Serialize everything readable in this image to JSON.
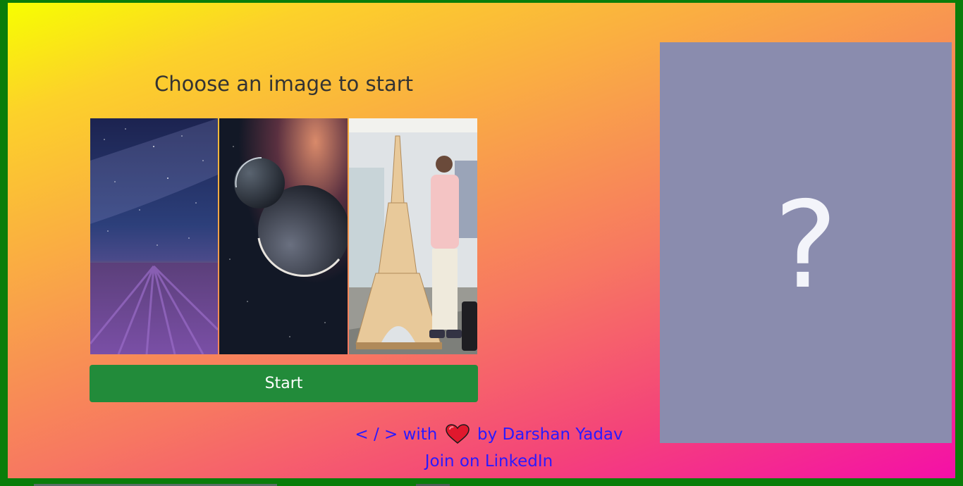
{
  "heading": "Choose an image to start",
  "images": [
    {
      "name": "lavender-night-sky",
      "alt": "Milky way over lavender field"
    },
    {
      "name": "planets-space",
      "alt": "Planets in space"
    },
    {
      "name": "eiffel-model-person",
      "alt": "Person with Eiffel tower model"
    }
  ],
  "start_label": "Start",
  "credit": {
    "prefix": "< / > with",
    "icon": "heart-icon",
    "suffix": "by Darshan Yadav"
  },
  "linkedin_label": "Join on LinkedIn",
  "preview_symbol": "?",
  "colors": {
    "border": "#0a7d0a",
    "button": "#228b3a",
    "link": "#2a1aff",
    "preview_bg": "#8a8cae"
  }
}
